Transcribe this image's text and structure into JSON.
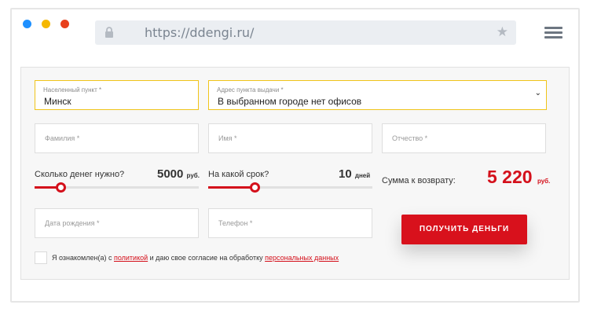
{
  "browser": {
    "url": "https://ddengi.ru/",
    "window_dots": [
      "#1e90ff",
      "#f5b800",
      "#e8401c"
    ]
  },
  "form": {
    "city": {
      "caption": "Населенный пункт *",
      "value": "Минск"
    },
    "office": {
      "caption": "Адрес пункта выдачи *",
      "value": "В выбранном городе нет офисов"
    },
    "surname": {
      "placeholder": "Фамилия *"
    },
    "name": {
      "placeholder": "Имя *"
    },
    "patronymic": {
      "placeholder": "Отчество *"
    },
    "amount": {
      "label": "Сколько денег нужно?",
      "value": "5000",
      "unit": "руб.",
      "level": 0.16
    },
    "term": {
      "label": "На какой срок?",
      "value": "10",
      "unit": "дней",
      "level": 0.28
    },
    "total": {
      "label": "Сумма к возврату:",
      "value": "5 220",
      "unit": "руб."
    },
    "birthdate": {
      "placeholder": "Дата рождения *"
    },
    "phone": {
      "placeholder": "Телефон *"
    },
    "submit_label": "ПОЛУЧИТЬ ДЕНЬГИ",
    "consent": {
      "text_before": "Я ознакомлен(а) с ",
      "policy_link": "политикой",
      "text_middle": " и даю свое согласие на обработку ",
      "data_link": "персональных данных"
    }
  },
  "colors": {
    "accent": "#d4101b",
    "active_border": "#f0c419"
  }
}
